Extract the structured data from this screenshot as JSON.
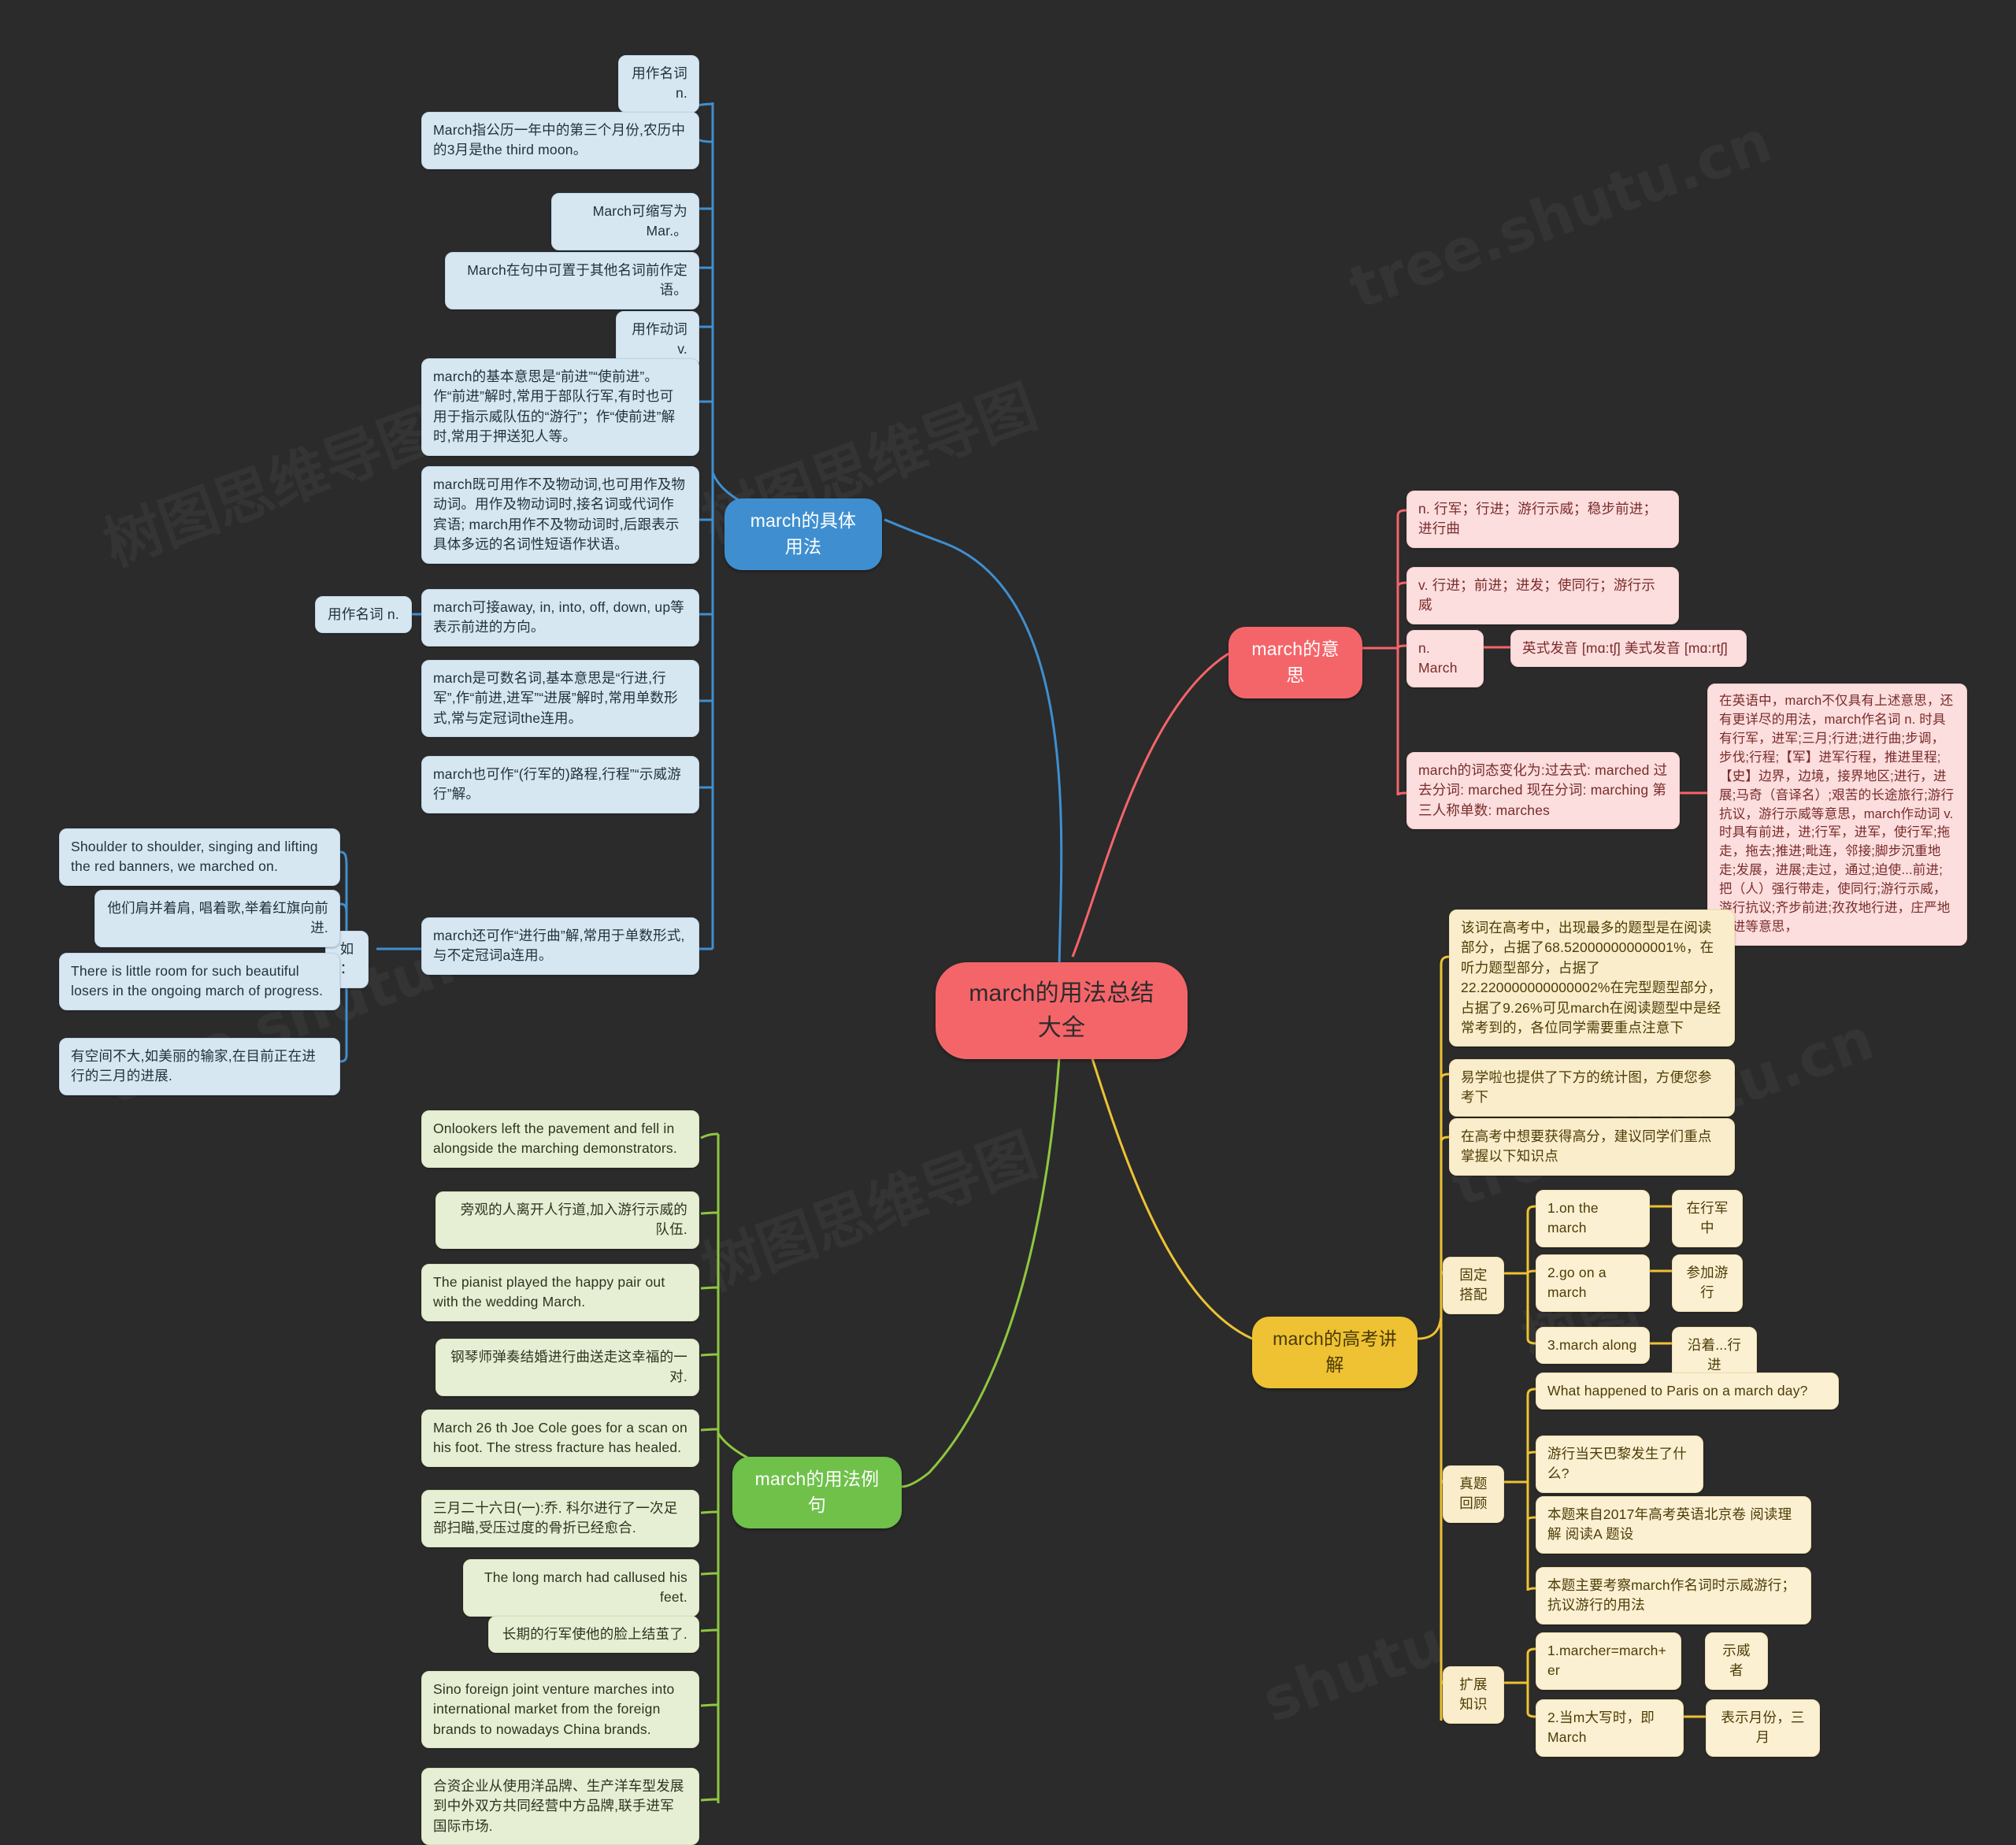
{
  "root": {
    "label": "march的用法总结大全"
  },
  "branches": {
    "usage": {
      "label": "march的具体用法",
      "color": "#3f8fd0",
      "noun_label_1": "用作名词 n.",
      "items": [
        "March指公历一年中的第三个月份,农历中的3月是the third moon。",
        "March可缩写为Mar.。",
        "March在句中可置于其他名词前作定语。",
        "用作动词 v.",
        "march的基本意思是“前进”“使前进”。作“前进”解时,常用于部队行军,有时也可用于指示威队伍的“游行”；作“使前进”解时,常用于押送犯人等。",
        "march既可用作不及物动词,也可用作及物动词。用作及物动词时,接名词或代词作宾语; march用作不及物动词时,后跟表示具体多远的名词性短语作状语。",
        "用作名词 n.",
        "march可接away, in, into, off, down, up等表示前进的方向。",
        "march是可数名词,基本意思是“行进,行军”,作“前进,进军”“进展”解时,常用单数形式,常与定冠词the连用。",
        "march也可作“(行军的)路程,行程”“示威游行”解。",
        "march还可作“进行曲”解,常用于单数形式,与不定冠词a连用。"
      ],
      "example_label": "如：",
      "examples": [
        "Shoulder to shoulder, singing and lifting the red banners, we marched on.",
        "他们肩并着肩, 唱着歌,举着红旗向前进.",
        "There is little room for such beautiful losers in the ongoing march of progress.",
        "有空间不大,如美丽的输家,在目前正在进行的三月的进展."
      ]
    },
    "meaning": {
      "label": "march的意思",
      "color": "#f4656a",
      "items": [
        "n. 行军；行进；游行示威；稳步前进；进行曲",
        "v. 行进；前进；进发；使同行；游行示威",
        "n. March",
        "march的词态变化为:过去式: marched 过去分词: marched 现在分词: marching 第三人称单数: marches"
      ],
      "pronunciation": "英式发音 [mɑ:tʃ] 美式发音 [mɑ:rtʃ]",
      "detail": "在英语中，march不仅具有上述意思，还有更详尽的用法，march作名词 n. 时具有行军，进军;三月;行进;进行曲;步调，步伐;行程;【军】进军行程，推进里程;【史】边界，边境，接界地区;进行，进展;马奇（音译名）;艰苦的长途旅行;游行抗议，游行示威等意思，march作动词 v. 时具有前进，进;行军，进军，使行军;拖走，拖去;推进;毗连，邻接;脚步沉重地走;发展，进展;走过，通过;迫使...前进;把（人）强行带走，使同行;游行示威，游行抗议;齐步前进;孜孜地行进，庄严地行进等意思，"
    },
    "examples": {
      "label": "march的用法例句",
      "color": "#6fc14a",
      "items": [
        "Onlookers left the pavement and fell in alongside the marching demonstrators.",
        "旁观的人离开人行道,加入游行示威的队伍.",
        "The pianist played the happy pair out with the wedding March.",
        "钢琴师弹奏结婚进行曲送走这幸福的一对.",
        "March 26 th Joe Cole goes for a scan on his foot. The stress fracture has healed.",
        "三月二十六日(一):乔. 科尔进行了一次足部扫瞄,受压过度的骨折已经愈合.",
        "The long march had callused his feet.",
        "长期的行军使他的脸上结茧了.",
        "Sino foreign joint venture marches into international market from the foreign brands to nowadays China brands.",
        "合资企业从使用洋品牌、生产洋车型发展到中外双方共同经营中方品牌,联手进军国际市场."
      ]
    },
    "gaokao": {
      "label": "march的高考讲解",
      "color": "#eec233",
      "intro": [
        "该词在高考中，出现最多的题型是在阅读部分，占据了68.52000000000001%，在听力题型部分，占据了22.220000000000002%在完型题型部分，占据了9.26%可见march在阅读题型中是经常考到的，各位同学需要重点注意下",
        "易学啦也提供了下方的统计图，方便您参考下",
        "在高考中想要获得高分，建议同学们重点掌握以下知识点"
      ],
      "groups": [
        {
          "label": "固定搭配",
          "rows": [
            {
              "term": "1.on the march",
              "meaning": "在行军中"
            },
            {
              "term": "2.go on a march",
              "meaning": "参加游行"
            },
            {
              "term": "3.march along",
              "meaning": "沿着...行进"
            }
          ]
        },
        {
          "label": "真题回顾",
          "items": [
            "What happened to Paris on a march day?",
            "游行当天巴黎发生了什么?",
            "本题来自2017年高考英语北京卷 阅读理解 阅读A 题设",
            "本题主要考察march作名词时示威游行；抗议游行的用法"
          ]
        },
        {
          "label": "扩展知识",
          "rows": [
            {
              "term": "1.marcher=march+er",
              "meaning": "示威者"
            },
            {
              "term": "2.当m大写时，即March",
              "meaning": "表示月份，三月"
            }
          ]
        }
      ]
    }
  },
  "watermark": {
    "text": "树图思维导图 tree.shutu.cn"
  }
}
